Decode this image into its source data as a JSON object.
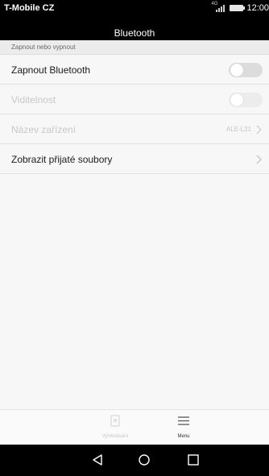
{
  "status_bar": {
    "carrier": "T-Mobile CZ",
    "time": "12:00"
  },
  "header": {
    "title": "Bluetooth"
  },
  "section": {
    "label": "Zapnout nebo vypnout"
  },
  "rows": [
    {
      "label": "Zapnout Bluetooth",
      "toggle": "off",
      "enabled": true
    },
    {
      "label": "Viditelnost",
      "toggle": "off",
      "enabled": false
    },
    {
      "label": "Název zařízení",
      "value": "ALE-L21",
      "enabled": false
    },
    {
      "label": "Zobrazit přijaté soubory",
      "enabled": true
    }
  ],
  "bottom_bar": {
    "search_label": "Vyhledávání",
    "menu_label": "Menu"
  },
  "icons": {
    "signal": "signal-icon",
    "battery": "battery-icon",
    "chevron": "chevron-right-icon",
    "search": "search-device-icon",
    "menu": "menu-icon",
    "back": "back-icon",
    "home": "home-icon",
    "recent": "recent-apps-icon"
  },
  "colors": {
    "status_bar": "#000000",
    "background": "#f7f7f7",
    "text": "#1a1a1a",
    "disabled_text": "#c8c8c8",
    "toggle_track": "#dcdcdc"
  }
}
